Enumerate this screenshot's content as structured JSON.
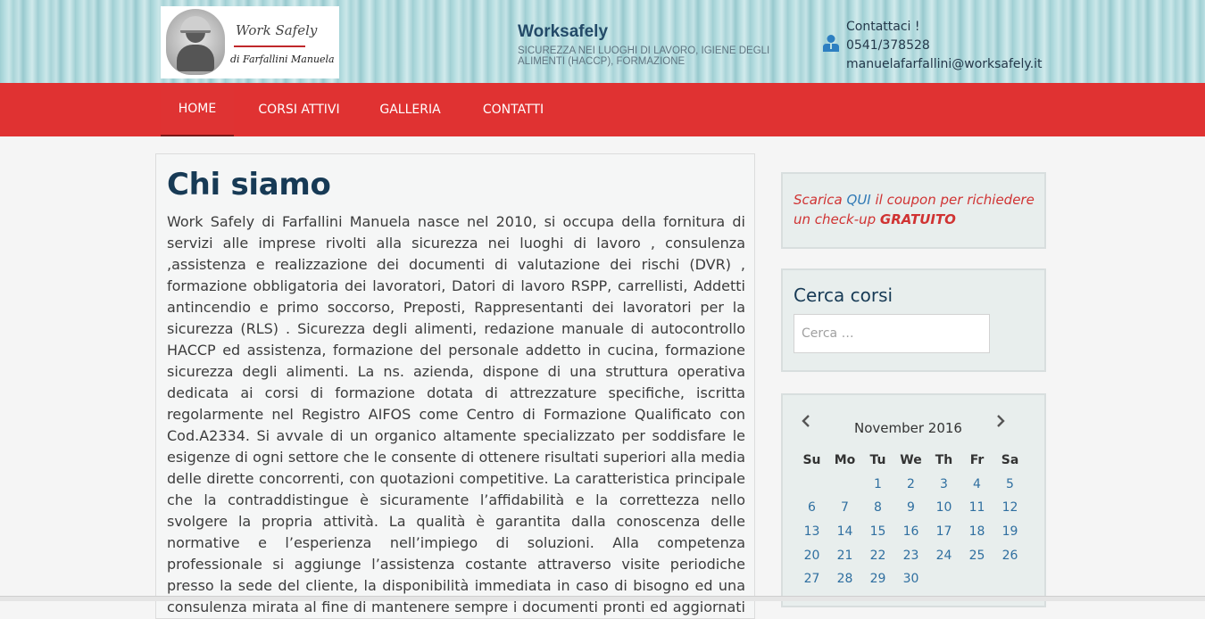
{
  "header": {
    "logo": {
      "line1": "Work Safely",
      "line2": "di Farfallini Manuela"
    },
    "site_title": "Worksafely",
    "site_description": "SICUREZZA NEI LUOGHI DI LAVORO, IGIENE DEGLI ALIMENTI (HACCP), FORMAZIONE",
    "contact": {
      "label": "Contattaci !",
      "phone": "0541/378528",
      "email": "manuelafarfallini@worksafely.it",
      "icon": "user-icon"
    }
  },
  "nav": {
    "items": [
      {
        "label": "HOME",
        "active": true
      },
      {
        "label": "CORSI ATTIVI",
        "active": false
      },
      {
        "label": "GALLERIA",
        "active": false
      },
      {
        "label": "CONTATTI",
        "active": false
      }
    ],
    "color": "#e03232"
  },
  "main": {
    "title": "Chi siamo",
    "body": "Work Safely di Farfallini Manuela nasce nel 2010, si occupa della fornitura di servizi alle imprese rivolti alla sicurezza nei luoghi di lavoro , consulenza ,assistenza e realizzazione dei documenti di valutazione dei rischi (DVR) , formazione obbligatoria dei lavoratori, Datori di lavoro RSPP, carrellisti, Addetti antincendio e primo soccorso, Preposti, Rappresentanti dei lavoratori per la sicurezza (RLS) . Sicurezza degli alimenti, redazione manuale di autocontrollo HACCP ed assistenza, formazione del personale addetto in cucina, formazione sicurezza degli alimenti. La ns. azienda, dispone di una struttura operativa dedicata ai corsi di formazione dotata di attrezzature specifiche, iscritta regolarmente nel Registro AIFOS come Centro di Formazione Qualificato con Cod.A2334. Si avvale di un organico altamente specializzato per soddisfare le esigenze di ogni settore che le consente di ottenere risultati superiori alla media delle dirette concorrenti, con quotazioni competitive. La caratteristica principale che la contraddistingue è sicuramente l’affidabilità e la correttezza nello svolgere la propria attività. La qualità è garantita dalla conoscenza delle normative e l’esperienza nell’impiego di soluzioni. Alla competenza professionale si aggiunge l’assistenza costante attraverso visite periodiche presso la sede del cliente, la disponibilità immediata in caso di bisogno ed una consulenza mirata al fine di mantenere sempre i documenti pronti ed aggiornati in caso di controlli da parte"
  },
  "sidebar": {
    "coupon": {
      "pre": "Scarica ",
      "link": "QUI",
      "mid": " il coupon per richiedere un check-up ",
      "strong": "GRATUITO"
    },
    "search": {
      "title": "Cerca corsi",
      "placeholder": "Cerca …"
    },
    "calendar": {
      "month": "November 2016",
      "weekdays": [
        "Su",
        "Mo",
        "Tu",
        "We",
        "Th",
        "Fr",
        "Sa"
      ],
      "weeks": [
        [
          "",
          "",
          "1",
          "2",
          "3",
          "4",
          "5"
        ],
        [
          "6",
          "7",
          "8",
          "9",
          "10",
          "11",
          "12"
        ],
        [
          "13",
          "14",
          "15",
          "16",
          "17",
          "18",
          "19"
        ],
        [
          "20",
          "21",
          "22",
          "23",
          "24",
          "25",
          "26"
        ],
        [
          "27",
          "28",
          "29",
          "30",
          "",
          "",
          ""
        ]
      ],
      "prev_icon": "chevron-left-icon",
      "next_icon": "chevron-right-icon"
    }
  }
}
